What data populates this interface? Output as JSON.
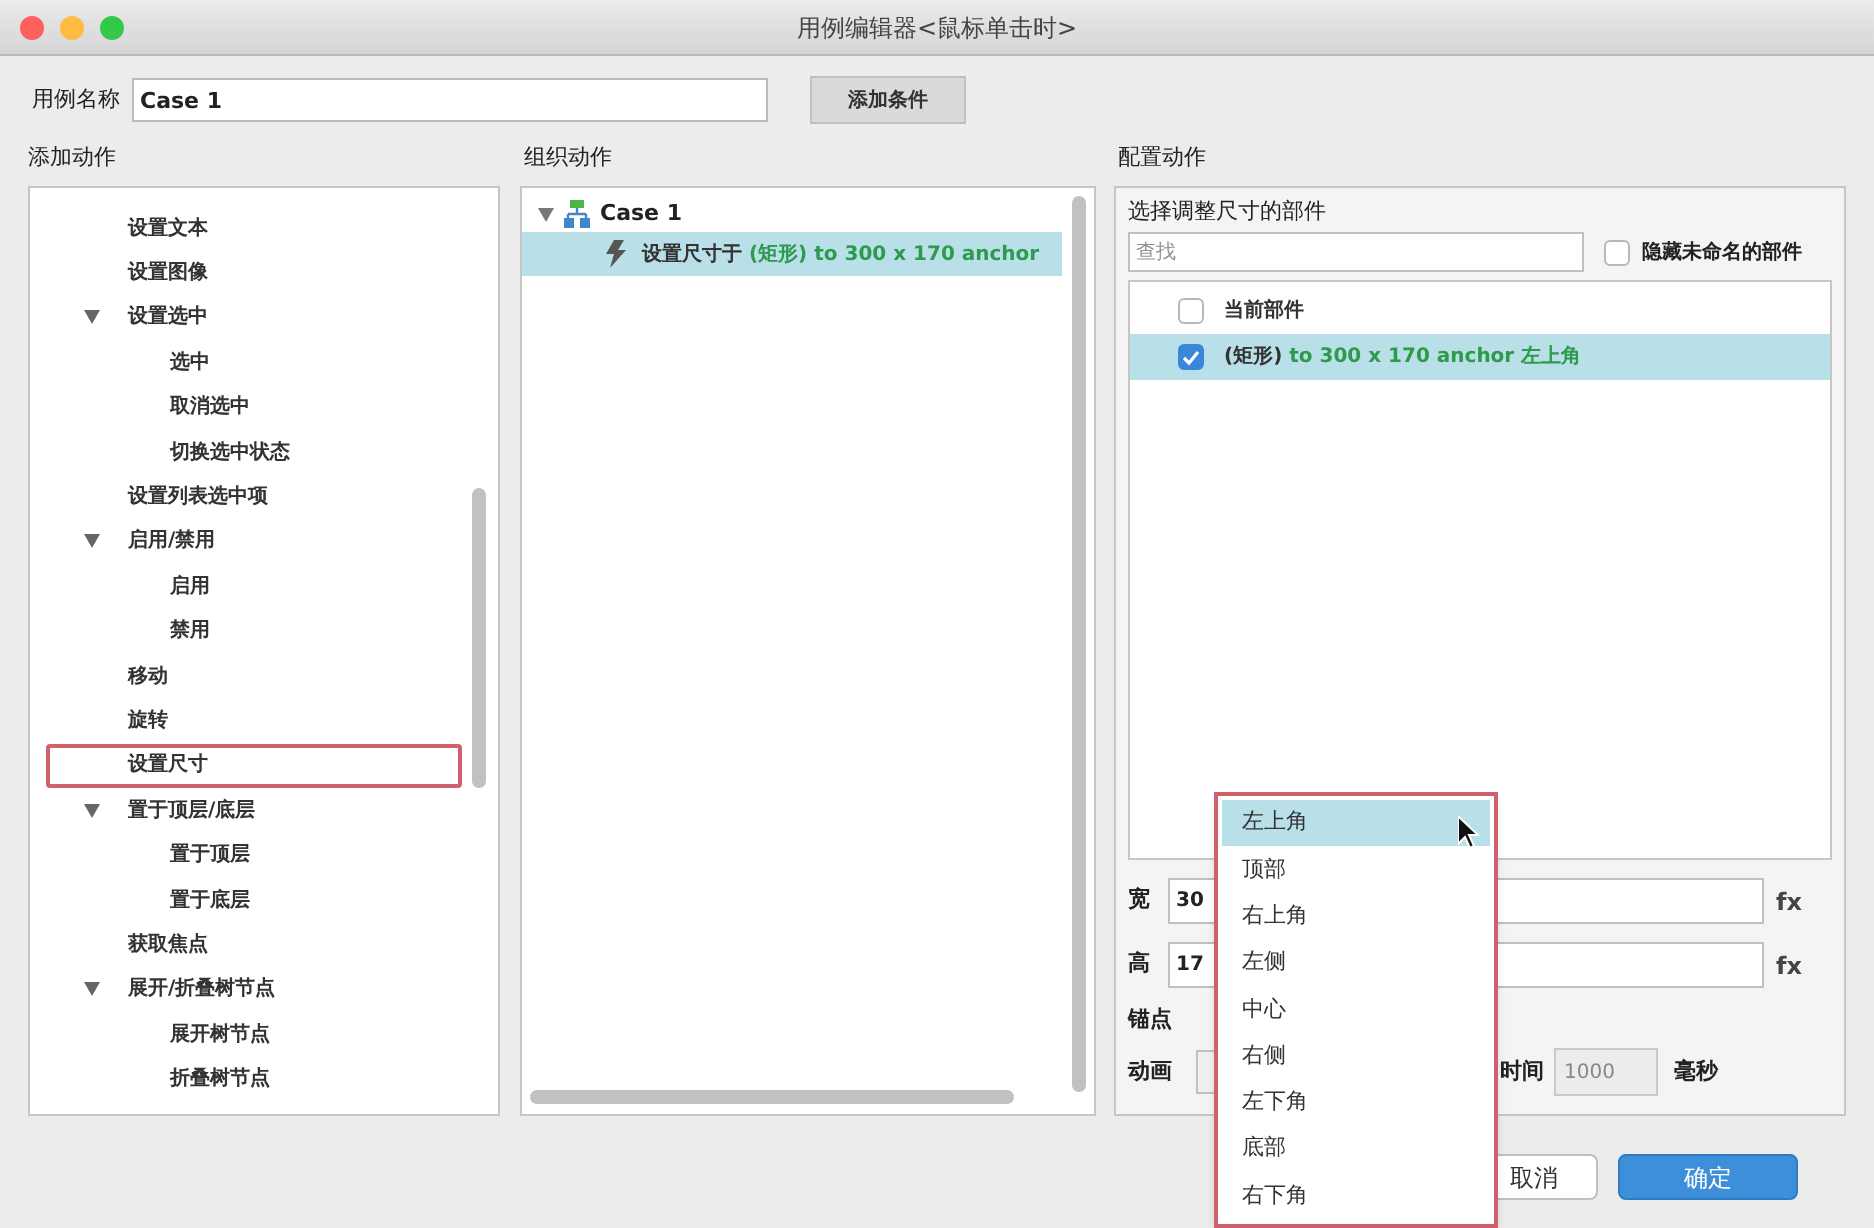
{
  "window": {
    "title": "用例编辑器<鼠标单击时>"
  },
  "case_name": {
    "label": "用例名称",
    "value": "Case 1"
  },
  "add_condition_button": "添加条件",
  "add_actions": {
    "title": "添加动作",
    "items": [
      {
        "label": "设置文本",
        "selected": false
      },
      {
        "label": "设置图像",
        "selected": false
      },
      {
        "label": "设置选中",
        "selected": false,
        "expanded": true,
        "children": [
          {
            "label": "选中",
            "selected": false
          },
          {
            "label": "取消选中",
            "selected": false
          },
          {
            "label": "切换选中状态",
            "selected": false
          }
        ]
      },
      {
        "label": "设置列表选中项",
        "selected": false
      },
      {
        "label": "启用/禁用",
        "selected": false,
        "expanded": true,
        "children": [
          {
            "label": "启用",
            "selected": false
          },
          {
            "label": "禁用",
            "selected": false
          }
        ]
      },
      {
        "label": "移动",
        "selected": false
      },
      {
        "label": "旋转",
        "selected": false
      },
      {
        "label": "设置尺寸",
        "selected": true
      },
      {
        "label": "置于顶层/底层",
        "selected": false,
        "expanded": true,
        "children": [
          {
            "label": "置于顶层",
            "selected": false
          },
          {
            "label": "置于底层",
            "selected": false
          }
        ]
      },
      {
        "label": "获取焦点",
        "selected": false
      },
      {
        "label": "展开/折叠树节点",
        "selected": false,
        "expanded": true,
        "children": [
          {
            "label": "展开树节点",
            "selected": false
          },
          {
            "label": "折叠树节点",
            "selected": false
          }
        ]
      }
    ]
  },
  "organize_actions": {
    "title": "组织动作",
    "case": {
      "label": "Case 1",
      "expanded": true
    },
    "actions": [
      {
        "text": "设置尺寸于 ",
        "detail": "(矩形) to 300 x 170 anchor",
        "selected": true
      }
    ]
  },
  "configure_action": {
    "title": "配置动作",
    "subtitle": "选择调整尺寸的部件",
    "search": {
      "placeholder": "查找"
    },
    "hide_unnamed": {
      "label": "隐藏未命名的部件",
      "checked": false
    },
    "widgets": [
      {
        "label": "当前部件",
        "checked": false,
        "selected": false
      },
      {
        "label": "(矩形)",
        "detail": " to 300 x 170 anchor 左上角",
        "checked": true,
        "selected": true
      }
    ],
    "width": {
      "label": "宽",
      "value": "30",
      "fx": "fx"
    },
    "height": {
      "label": "高",
      "value": "17",
      "fx": "fx"
    },
    "anchor": {
      "label": "锚点"
    },
    "animation": {
      "label": "动画",
      "time_label": "时间",
      "time_value": "1000",
      "unit": "毫秒"
    }
  },
  "anchor_menu": [
    {
      "label": "左上角",
      "selected": true
    },
    {
      "label": "顶部",
      "selected": false
    },
    {
      "label": "右上角",
      "selected": false
    },
    {
      "label": "左侧",
      "selected": false
    },
    {
      "label": "中心",
      "selected": false
    },
    {
      "label": "右侧",
      "selected": false
    },
    {
      "label": "左下角",
      "selected": false
    },
    {
      "label": "底部",
      "selected": false
    },
    {
      "label": "右下角",
      "selected": false
    }
  ],
  "buttons": [
    {
      "label": "取消",
      "kind": "default"
    },
    {
      "label": "确定",
      "kind": "primary"
    }
  ]
}
